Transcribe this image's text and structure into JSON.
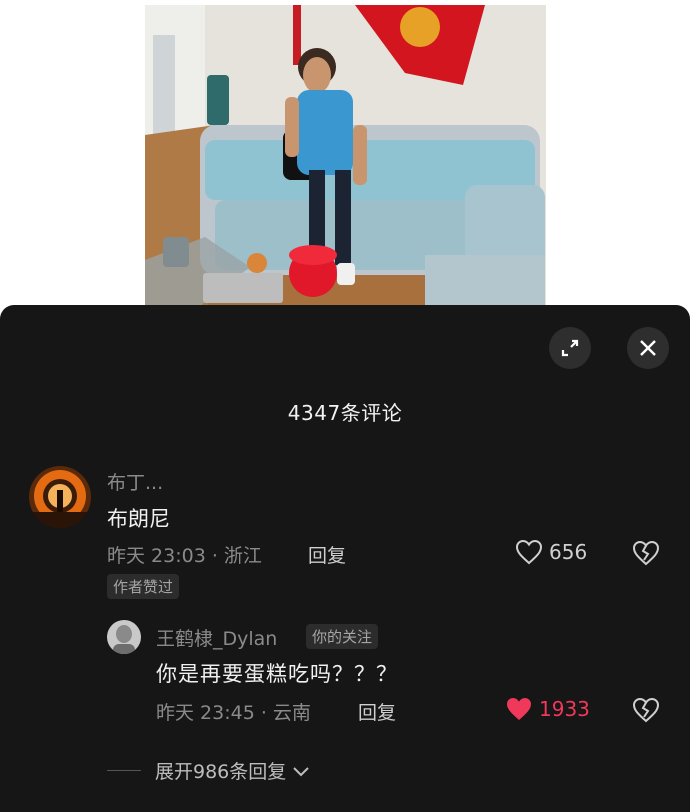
{
  "comments_sheet": {
    "title": "4347条评论",
    "expand_icon": "expand-icon",
    "close_icon": "close-icon"
  },
  "comments": [
    {
      "username": "布丁...",
      "text": "布朗尼",
      "time_location": "昨天 23:03 · 浙江",
      "reply_label": "回复",
      "like_count": "656",
      "liked": false,
      "badge": "作者赞过"
    }
  ],
  "reply": {
    "username": "王鹤棣_Dylan",
    "badge": "你的关注",
    "text": "你是再要蛋糕吃吗？？？",
    "time_location": "昨天 23:45 · 云南",
    "reply_label": "回复",
    "like_count": "1933",
    "liked": true
  },
  "expand_replies_label": "展开986条回复",
  "colors": {
    "sheet_bg": "#161616",
    "liked_red": "#f0385a",
    "muted_text": "#8a8a8a"
  }
}
